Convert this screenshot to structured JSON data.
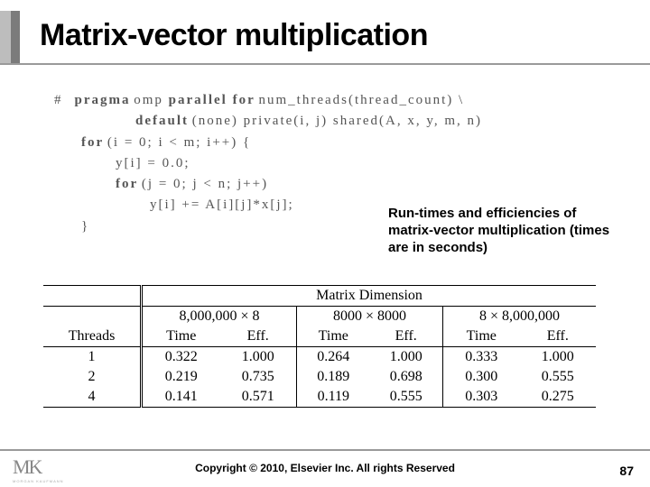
{
  "title": "Matrix-vector multiplication",
  "code": {
    "line1_hash": "#",
    "line1_kw1": "pragma",
    "line1_txt1": " omp ",
    "line1_kw2": "parallel for",
    "line1_txt2": " num_threads(thread_count) \\",
    "line2_kw": "default",
    "line2_txt": "(none) private(i, j) shared(A, x, y, m, n)",
    "line3_kw": "for",
    "line3_txt": " (i = 0; i < m; i++) {",
    "line4": "y[i] = 0.0;",
    "line5_kw": "for",
    "line5_txt": " (j = 0; j < n; j++)",
    "line6": "y[i] += A[i][j]*x[j];",
    "line7": "}"
  },
  "caption": "Run-times and efficiencies of matrix-vector multiplication (times are in seconds)",
  "table": {
    "head_super": "Matrix Dimension",
    "head_threads": "Threads",
    "cols": [
      {
        "dim": "8,000,000 × 8",
        "l": "Time",
        "r": "Eff."
      },
      {
        "dim": "8000 × 8000",
        "l": "Time",
        "r": "Eff."
      },
      {
        "dim": "8 × 8,000,000",
        "l": "Time",
        "r": "Eff."
      }
    ],
    "rows": [
      {
        "t": "1",
        "v": [
          "0.322",
          "1.000",
          "0.264",
          "1.000",
          "0.333",
          "1.000"
        ]
      },
      {
        "t": "2",
        "v": [
          "0.219",
          "0.735",
          "0.189",
          "0.698",
          "0.300",
          "0.555"
        ]
      },
      {
        "t": "4",
        "v": [
          "0.141",
          "0.571",
          "0.119",
          "0.555",
          "0.303",
          "0.275"
        ]
      }
    ]
  },
  "footer": {
    "copyright": "Copyright © 2010, Elsevier Inc. All rights Reserved",
    "page": "87"
  },
  "logo": {
    "mk": "MK",
    "sub": "MORGAN KAUFMANN"
  },
  "chart_data": {
    "type": "table",
    "title": "Run-times and efficiencies of matrix-vector multiplication (times are in seconds)",
    "columns": [
      "Threads",
      "8,000,000×8 Time",
      "8,000,000×8 Eff.",
      "8000×8000 Time",
      "8000×8000 Eff.",
      "8×8,000,000 Time",
      "8×8,000,000 Eff."
    ],
    "rows": [
      [
        1,
        0.322,
        1.0,
        0.264,
        1.0,
        0.333,
        1.0
      ],
      [
        2,
        0.219,
        0.735,
        0.189,
        0.698,
        0.3,
        0.555
      ],
      [
        4,
        0.141,
        0.571,
        0.119,
        0.555,
        0.303,
        0.275
      ]
    ]
  }
}
